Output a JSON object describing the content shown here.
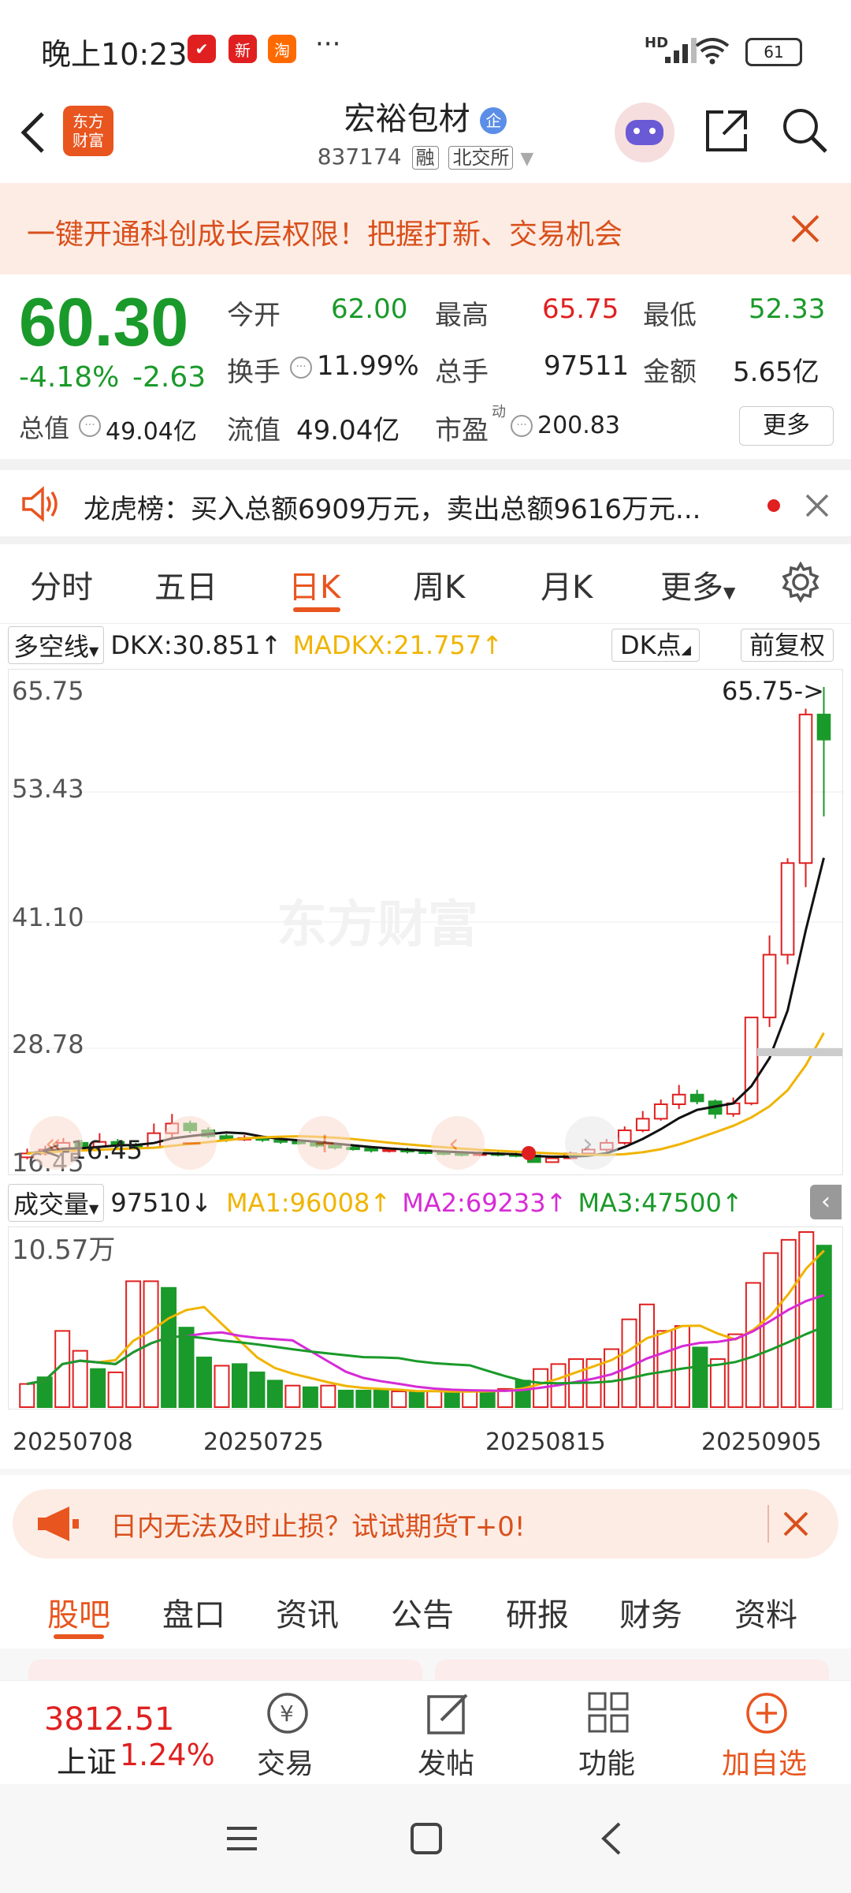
{
  "status_bar": {
    "time": "晚上10:23",
    "dots": "···",
    "battery": "61",
    "network": "HD"
  },
  "header": {
    "logo_line1": "东方",
    "logo_line2": "财富",
    "stock_name": "宏裕包材",
    "name_badge": "企",
    "code": "837174",
    "tag_margin": "融",
    "tag_exchange": "北交所"
  },
  "promo_banner": {
    "text": "一键开通科创成长层权限！把握打新、交易机会"
  },
  "quote": {
    "price": "60.30",
    "change_pct": "-4.18%",
    "change_amt": "-2.63",
    "open_label": "今开",
    "open": "62.00",
    "high_label": "最高",
    "high": "65.75",
    "low_label": "最低",
    "low": "52.33",
    "turnover_label": "换手",
    "turnover": "11.99%",
    "volume_label": "总手",
    "volume": "97511",
    "amount_label": "金额",
    "amount": "5.65亿",
    "mcap_label": "总值",
    "mcap": "49.04亿",
    "float_label": "流值",
    "float_mcap": "49.04亿",
    "pe_label": "市盈",
    "pe_sup": "动",
    "pe": "200.83",
    "more_label": "更多"
  },
  "dragon_tiger": {
    "text": "龙虎榜：买入总额6909万元，卖出总额9616万元..."
  },
  "chart_tabs": {
    "items": [
      "分时",
      "五日",
      "日K",
      "周K",
      "月K",
      "更多"
    ],
    "active": "日K"
  },
  "indicator": {
    "selector": "多空线",
    "dkx": "DKX:30.851↑",
    "madkx": "MADKX:21.757↑",
    "dk_btn": "DK点",
    "adjust_btn": "前复权"
  },
  "kline_axis": {
    "labels": [
      "65.75",
      "53.43",
      "41.10",
      "28.78",
      "16.45"
    ],
    "high_marker": "65.75->",
    "low_marker": "<-16.45"
  },
  "volume_panel": {
    "selector": "成交量",
    "vol": "97510↓",
    "ma1": "MA1:96008↑",
    "ma2": "MA2:69233↑",
    "ma3": "MA3:47500↑",
    "axis_top": "10.57万"
  },
  "date_axis": {
    "labels": [
      "20250708",
      "20250725",
      "20250815",
      "20250905"
    ]
  },
  "futures_banner": {
    "text": "日内无法及时止损？试试期货T+0!"
  },
  "bottom_tabs": {
    "items": [
      "股吧",
      "盘口",
      "资讯",
      "公告",
      "研报",
      "财务",
      "资料"
    ],
    "active": "股吧"
  },
  "bottom_nav": {
    "index_value": "3812.51",
    "index_name": "上证",
    "index_change": "1.24%",
    "trade": "交易",
    "post": "发帖",
    "func": "功能",
    "add_watch": "加自选"
  },
  "watermark": "东方财富",
  "colors": {
    "up": "#e02020",
    "down": "#1a9a2a",
    "accent": "#e8551f",
    "ma1": "#f0b400",
    "ma2": "#d62bd6",
    "ma3": "#1a9a2a"
  },
  "chart_data": {
    "type": "candlestick",
    "ylim": [
      16.45,
      65.75
    ],
    "candles": [
      {
        "o": 17.0,
        "c": 17.4,
        "h": 17.9,
        "l": 16.8
      },
      {
        "o": 17.4,
        "c": 17.8,
        "h": 18.2,
        "l": 17.2
      },
      {
        "o": 17.8,
        "c": 18.5,
        "h": 19.0,
        "l": 17.6
      },
      {
        "o": 18.5,
        "c": 18.1,
        "h": 18.8,
        "l": 17.9
      },
      {
        "o": 18.1,
        "c": 18.6,
        "h": 19.5,
        "l": 18.0
      },
      {
        "o": 18.6,
        "c": 18.2,
        "h": 18.9,
        "l": 17.9
      },
      {
        "o": 18.2,
        "c": 18.0,
        "h": 18.5,
        "l": 17.8
      },
      {
        "o": 18.0,
        "c": 19.5,
        "h": 20.5,
        "l": 17.9
      },
      {
        "o": 19.5,
        "c": 20.5,
        "h": 21.5,
        "l": 19.0
      },
      {
        "o": 20.5,
        "c": 19.8,
        "h": 20.8,
        "l": 19.5
      },
      {
        "o": 19.8,
        "c": 19.2,
        "h": 20.1,
        "l": 19.0
      },
      {
        "o": 19.2,
        "c": 18.9,
        "h": 19.4,
        "l": 18.6
      },
      {
        "o": 18.9,
        "c": 19.0,
        "h": 19.3,
        "l": 18.7
      },
      {
        "o": 19.0,
        "c": 18.8,
        "h": 19.2,
        "l": 18.6
      },
      {
        "o": 18.8,
        "c": 18.6,
        "h": 19.0,
        "l": 18.4
      },
      {
        "o": 18.6,
        "c": 18.5,
        "h": 18.8,
        "l": 18.3
      },
      {
        "o": 18.5,
        "c": 18.2,
        "h": 18.7,
        "l": 18.0
      },
      {
        "o": 18.2,
        "c": 18.0,
        "h": 18.4,
        "l": 17.8
      },
      {
        "o": 18.0,
        "c": 17.9,
        "h": 18.2,
        "l": 17.7
      },
      {
        "o": 17.9,
        "c": 17.7,
        "h": 18.1,
        "l": 17.5
      },
      {
        "o": 17.7,
        "c": 17.8,
        "h": 18.0,
        "l": 17.5
      },
      {
        "o": 17.8,
        "c": 17.6,
        "h": 18.0,
        "l": 17.4
      },
      {
        "o": 17.6,
        "c": 17.5,
        "h": 17.8,
        "l": 17.3
      },
      {
        "o": 17.5,
        "c": 17.4,
        "h": 17.7,
        "l": 17.2
      },
      {
        "o": 17.4,
        "c": 17.3,
        "h": 17.6,
        "l": 17.1
      },
      {
        "o": 17.3,
        "c": 17.4,
        "h": 17.6,
        "l": 17.1
      },
      {
        "o": 17.4,
        "c": 17.3,
        "h": 17.6,
        "l": 17.1
      },
      {
        "o": 17.3,
        "c": 17.2,
        "h": 17.5,
        "l": 17.0
      },
      {
        "o": 17.2,
        "c": 16.5,
        "h": 17.3,
        "l": 16.45
      },
      {
        "o": 16.5,
        "c": 16.9,
        "h": 17.1,
        "l": 16.45
      },
      {
        "o": 16.9,
        "c": 17.4,
        "h": 17.6,
        "l": 16.8
      },
      {
        "o": 17.4,
        "c": 17.8,
        "h": 18.0,
        "l": 17.2
      },
      {
        "o": 17.8,
        "c": 18.5,
        "h": 18.9,
        "l": 17.6
      },
      {
        "o": 18.5,
        "c": 19.8,
        "h": 20.2,
        "l": 18.3
      },
      {
        "o": 19.8,
        "c": 21.0,
        "h": 21.8,
        "l": 19.6
      },
      {
        "o": 21.0,
        "c": 22.5,
        "h": 23.0,
        "l": 20.8
      },
      {
        "o": 22.5,
        "c": 23.5,
        "h": 24.5,
        "l": 22.0
      },
      {
        "o": 23.5,
        "c": 22.8,
        "h": 24.0,
        "l": 22.5
      },
      {
        "o": 22.8,
        "c": 21.5,
        "h": 23.0,
        "l": 21.0
      },
      {
        "o": 21.5,
        "c": 22.6,
        "h": 23.2,
        "l": 21.2
      },
      {
        "o": 22.6,
        "c": 31.5,
        "h": 31.5,
        "l": 22.4
      },
      {
        "o": 31.5,
        "c": 38.0,
        "h": 40.0,
        "l": 30.5
      },
      {
        "o": 38.0,
        "c": 47.5,
        "h": 48.0,
        "l": 37.0
      },
      {
        "o": 47.5,
        "c": 62.9,
        "h": 63.5,
        "l": 45.0
      },
      {
        "o": 62.9,
        "c": 60.3,
        "h": 65.75,
        "l": 52.33
      }
    ],
    "volume": {
      "max_label": "10.57万",
      "values": [
        1.4,
        1.8,
        4.6,
        3.4,
        2.3,
        2.1,
        7.6,
        7.6,
        7.2,
        4.8,
        3.0,
        2.5,
        2.6,
        2.1,
        1.6,
        1.3,
        1.2,
        1.3,
        1.0,
        1.0,
        1.0,
        0.95,
        0.9,
        0.95,
        0.9,
        1.0,
        1.0,
        1.1,
        1.6,
        2.3,
        2.6,
        2.9,
        2.9,
        3.5,
        5.3,
        6.2,
        4.6,
        4.9,
        3.6,
        2.9,
        4.4,
        7.5,
        9.3,
        10.1,
        10.57,
        9.75
      ],
      "up": [
        true,
        false,
        true,
        true,
        false,
        true,
        true,
        true,
        false,
        false,
        false,
        true,
        false,
        false,
        false,
        true,
        false,
        true,
        false,
        false,
        false,
        true,
        false,
        true,
        false,
        true,
        false,
        true,
        false,
        true,
        true,
        true,
        true,
        true,
        true,
        true,
        true,
        true,
        false,
        true,
        true,
        true,
        true,
        true,
        true,
        false
      ]
    }
  }
}
